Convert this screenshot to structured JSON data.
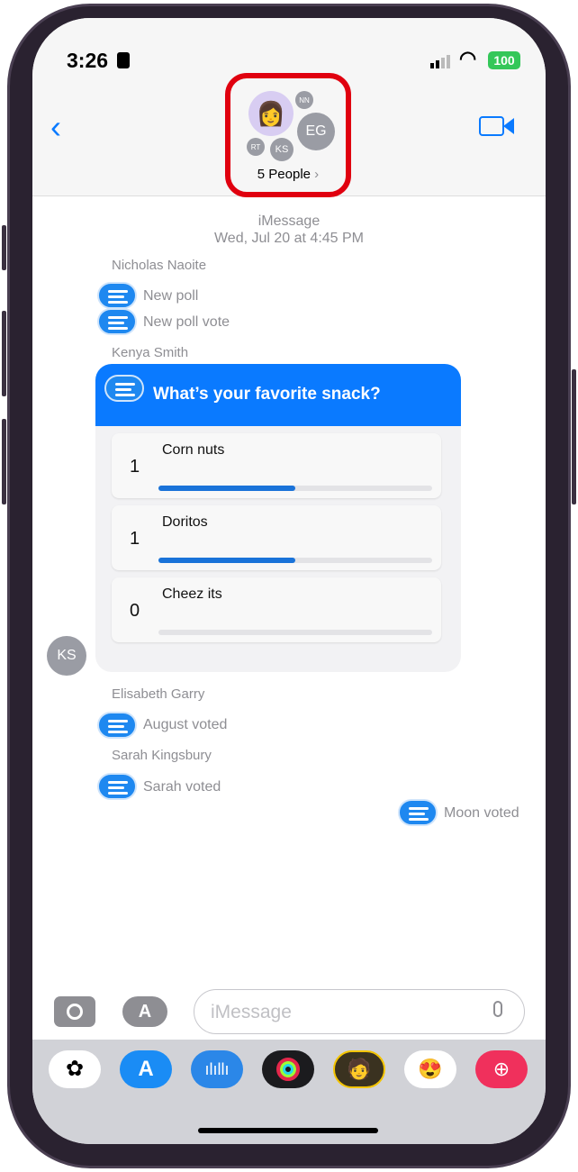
{
  "status": {
    "time": "3:26",
    "battery": "100"
  },
  "header": {
    "title": "5 People",
    "avatars": [
      "NN",
      "EG",
      "RT",
      "KS"
    ]
  },
  "thread": {
    "service": "iMessage",
    "date": "Wed, Jul 20 at 4:45 PM",
    "items": [
      {
        "sender": "Nicholas Naoite",
        "events": [
          "New poll",
          "New poll vote"
        ]
      },
      {
        "sender": "Kenya Smith"
      }
    ],
    "poll": {
      "question": "What’s your favorite snack?",
      "sender_initials": "KS",
      "options": [
        {
          "label": "Corn nuts",
          "count": "1",
          "fraction": 0.5
        },
        {
          "label": "Doritos",
          "count": "1",
          "fraction": 0.5
        },
        {
          "label": "Cheez its",
          "count": "0",
          "fraction": 0
        }
      ]
    },
    "after": [
      {
        "sender": "Elisabeth Garry",
        "event": "August voted"
      },
      {
        "sender": "Sarah Kingsbury",
        "event": "Sarah voted"
      }
    ],
    "own_event": "Moon voted"
  },
  "composer": {
    "placeholder": "iMessage"
  },
  "apps": [
    "photos",
    "app-store",
    "voice-memo",
    "activity",
    "memoji-camera",
    "memoji-stickers",
    "search-images"
  ],
  "colors": {
    "accent": "#0a7aff",
    "highlight": "#e0000f",
    "battery": "#34c759"
  }
}
